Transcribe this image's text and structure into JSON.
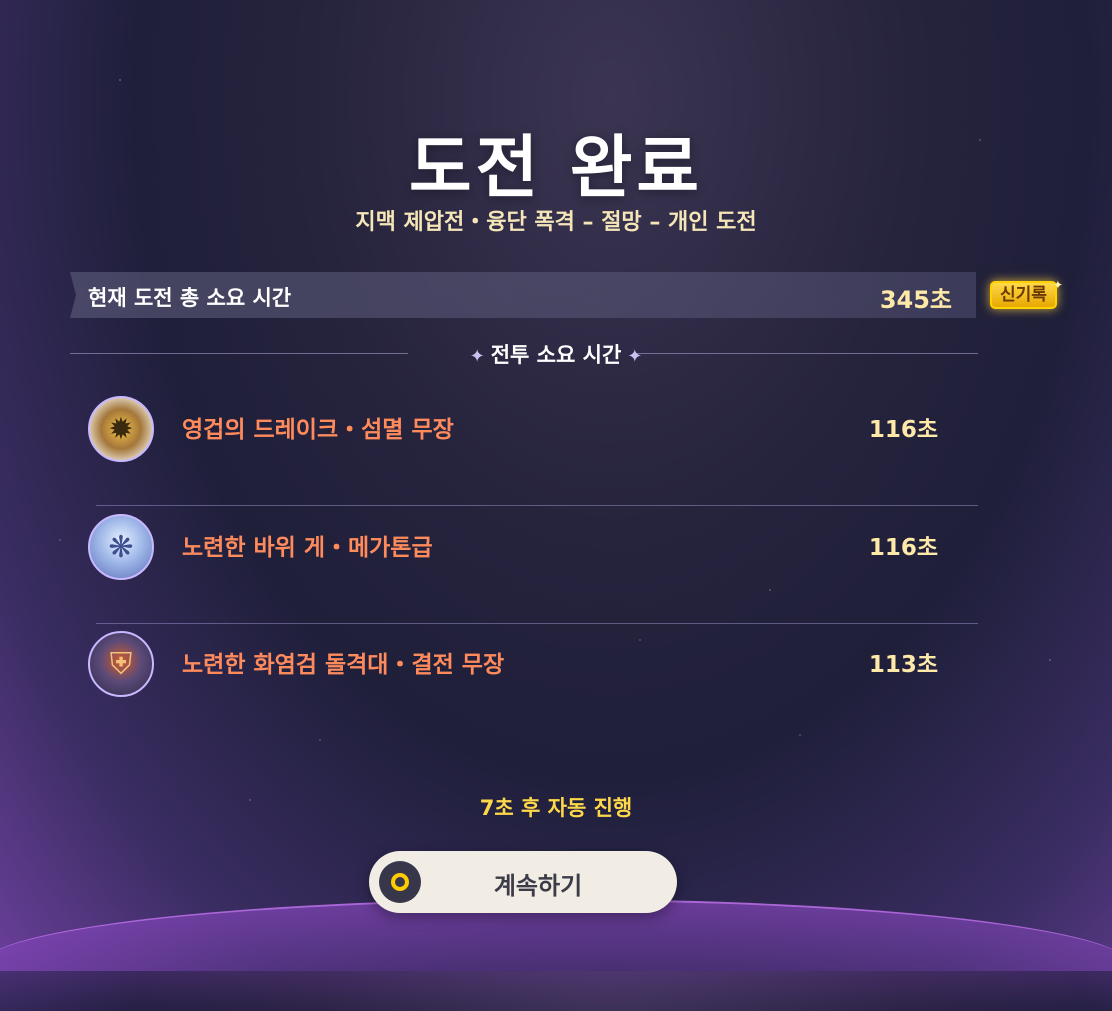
{
  "header": {
    "title": "도전 완료",
    "subtitle": "지맥 제압전・융단 폭격 – 절망 – 개인 도전"
  },
  "total": {
    "label": "현재 도전 총 소요 시간",
    "value": "345초",
    "badge": "신기록"
  },
  "battle_section": {
    "title": "전투 소요 시간"
  },
  "enemies": [
    {
      "name": "영겁의 드레이크・섬멸 무장",
      "time": "116초",
      "icon": "drake-emblem-icon"
    },
    {
      "name": "노련한 바위 게・메가톤급",
      "time": "116초",
      "icon": "rock-crab-icon"
    },
    {
      "name": "노련한 화염검 돌격대・결전 무장",
      "time": "113초",
      "icon": "flame-blade-trooper-icon"
    }
  ],
  "footer": {
    "countdown": "7초 후 자동 진행",
    "continue_label": "계속하기"
  },
  "colors": {
    "enemy_name": "#ff8a5c",
    "time": "#ffe9a8",
    "badge": "#ffd200",
    "countdown": "#ffd84a"
  }
}
